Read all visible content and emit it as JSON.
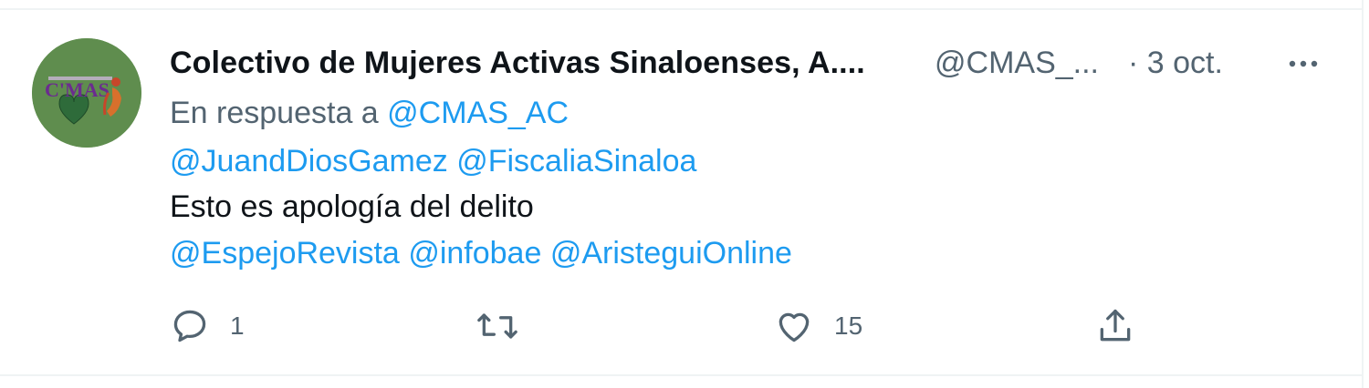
{
  "tweet": {
    "author": {
      "display_name": "Colectivo de Mujeres Activas Sinaloenses, A....",
      "handle": "@CMAS_...",
      "avatar_text": "C'MAS"
    },
    "date": "· 3 oct.",
    "more_icon": "more-horizontal-icon",
    "reply_to": {
      "prefix": "En respuesta a",
      "handle": "@CMAS_AC"
    },
    "mentions_line1": [
      "@JuandDiosGamez",
      "@FiscaliaSinaloa"
    ],
    "text": "Esto es apología del delito",
    "mentions_line2": [
      "@EspejoRevista",
      "@infobae",
      "@AristeguiOnline"
    ]
  },
  "actions": {
    "reply": {
      "icon": "reply-icon",
      "count": "1"
    },
    "retweet": {
      "icon": "retweet-icon",
      "count": ""
    },
    "like": {
      "icon": "heart-icon",
      "count": "15"
    },
    "share": {
      "icon": "share-icon",
      "count": ""
    }
  },
  "colors": {
    "text_primary": "#0f1419",
    "text_secondary": "#536471",
    "link": "#1d9bf0",
    "avatar_bg": "#5f8d4e"
  }
}
